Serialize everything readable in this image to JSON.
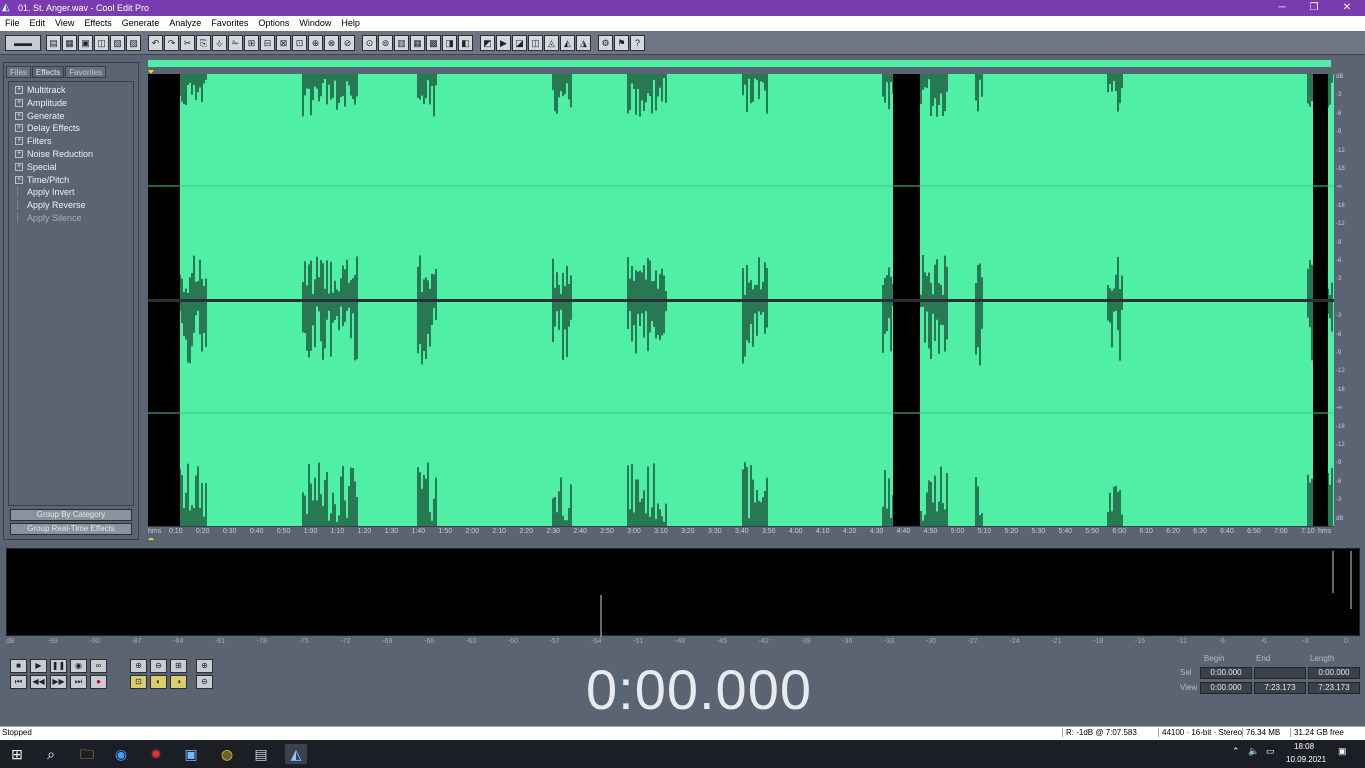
{
  "window": {
    "title": "01. St. Anger.wav - Cool Edit Pro",
    "minimize": "─",
    "maximize": "❐",
    "close": "✕"
  },
  "menu": [
    "File",
    "Edit",
    "View",
    "Effects",
    "Generate",
    "Analyze",
    "Favorites",
    "Options",
    "Window",
    "Help"
  ],
  "toolbar_icons": [
    "▤",
    "▦",
    "▣",
    "◫",
    "▧",
    "▨",
    "↶",
    "↷",
    "✂",
    "⎘",
    "⎀",
    "✁",
    "⊞",
    "⊟",
    "⊠",
    "⊡",
    "⊕",
    "⊗",
    "⊘",
    "⊙",
    "⊚",
    "▥",
    "▦",
    "▩",
    "◨",
    "◧",
    "◩",
    "▶",
    "◪",
    "◫",
    "◬",
    "◭",
    "◮",
    "⚙",
    "⚑",
    "?"
  ],
  "panel": {
    "tabs": [
      "Files",
      "Effects",
      "Favorites"
    ],
    "active_tab": "Effects",
    "tree": [
      {
        "label": "Multitrack",
        "type": "group"
      },
      {
        "label": "Amplitude",
        "type": "group"
      },
      {
        "label": "Generate",
        "type": "group"
      },
      {
        "label": "Delay Effects",
        "type": "group"
      },
      {
        "label": "Filters",
        "type": "group"
      },
      {
        "label": "Noise Reduction",
        "type": "group"
      },
      {
        "label": "Special",
        "type": "group"
      },
      {
        "label": "Time/Pitch",
        "type": "group"
      },
      {
        "label": "Apply Invert",
        "type": "leaf"
      },
      {
        "label": "Apply Reverse",
        "type": "leaf"
      },
      {
        "label": "Apply Silence",
        "type": "leaf",
        "disabled": true
      }
    ],
    "group_by_category": "Group By Category",
    "group_realtime": "Group Real-Time Effects"
  },
  "waveform": {
    "color": "#4ff0a6",
    "background": "#000000",
    "duration": "7:23.173"
  },
  "time_ruler": [
    "hms",
    "0:10",
    "0:20",
    "0:30",
    "0:40",
    "0:50",
    "1:00",
    "1:10",
    "1:20",
    "1:30",
    "1:40",
    "1:50",
    "2:00",
    "2:10",
    "2:20",
    "2:30",
    "2:40",
    "2:50",
    "3:00",
    "3:10",
    "3:20",
    "3:30",
    "3:40",
    "3:50",
    "4:00",
    "4:10",
    "4:20",
    "4:30",
    "4:40",
    "4:50",
    "5:00",
    "5:10",
    "5:20",
    "5:30",
    "5:40",
    "5:50",
    "6:00",
    "6:10",
    "6:20",
    "6:30",
    "6:40",
    "6:50",
    "7:00",
    "7:10",
    "hms"
  ],
  "db_scale": [
    "dB",
    "-3",
    "-6",
    "-9",
    "-12",
    "-18",
    "-∞",
    "-18",
    "-12",
    "-9",
    "-6",
    "-3",
    "",
    "-3",
    "-6",
    "-9",
    "-12",
    "-18",
    "-∞",
    "-18",
    "-12",
    "-9",
    "-6",
    "-3",
    "dB"
  ],
  "meter_scale": [
    "dB",
    "-93",
    "-90",
    "-87",
    "-84",
    "-81",
    "-78",
    "-75",
    "-72",
    "-69",
    "-66",
    "-63",
    "-60",
    "-57",
    "-54",
    "-51",
    "-48",
    "-45",
    "-42",
    "-39",
    "-36",
    "-33",
    "-30",
    "-27",
    "-24",
    "-21",
    "-18",
    "-15",
    "-12",
    "-9",
    "-6",
    "-3",
    "0"
  ],
  "transport": {
    "stop": "■",
    "play": "▶",
    "pause": "❚❚",
    "play_to_end": "◉",
    "loop": "∞",
    "go_start": "⏮",
    "rewind": "◀◀",
    "ffwd": "▶▶",
    "go_end": "⏭",
    "record": "●"
  },
  "zoom": {
    "zoom_in": "⊕",
    "zoom_out": "⊖",
    "zoom_full": "⊞",
    "zoom_sel": "⊡",
    "zoom_l": "◐",
    "zoom_r": "◑",
    "zoom_in_v": "⊕",
    "zoom_out_v": "⊖"
  },
  "time_display": "0:00.000",
  "selection": {
    "headers": [
      "Begin",
      "End",
      "Length"
    ],
    "rows": [
      {
        "label": "Sel",
        "begin": "0:00.000",
        "end": "",
        "length": "0:00.000"
      },
      {
        "label": "View",
        "begin": "0:00.000",
        "end": "7:23.173",
        "length": "7:23.173"
      }
    ]
  },
  "status": {
    "state": "Stopped",
    "cursor": "R: -1dB @  7:07.583",
    "format": "44100 · 16-bit · Stereo",
    "size": "76.34 MB",
    "free": "31.24 GB free"
  },
  "taskbar": {
    "time": "18:08",
    "date": "10.09.2021",
    "icons": [
      "⊞",
      "⌕",
      "🗀",
      "◉",
      "✹",
      "▣",
      "◍",
      "▤",
      "◭"
    ]
  }
}
